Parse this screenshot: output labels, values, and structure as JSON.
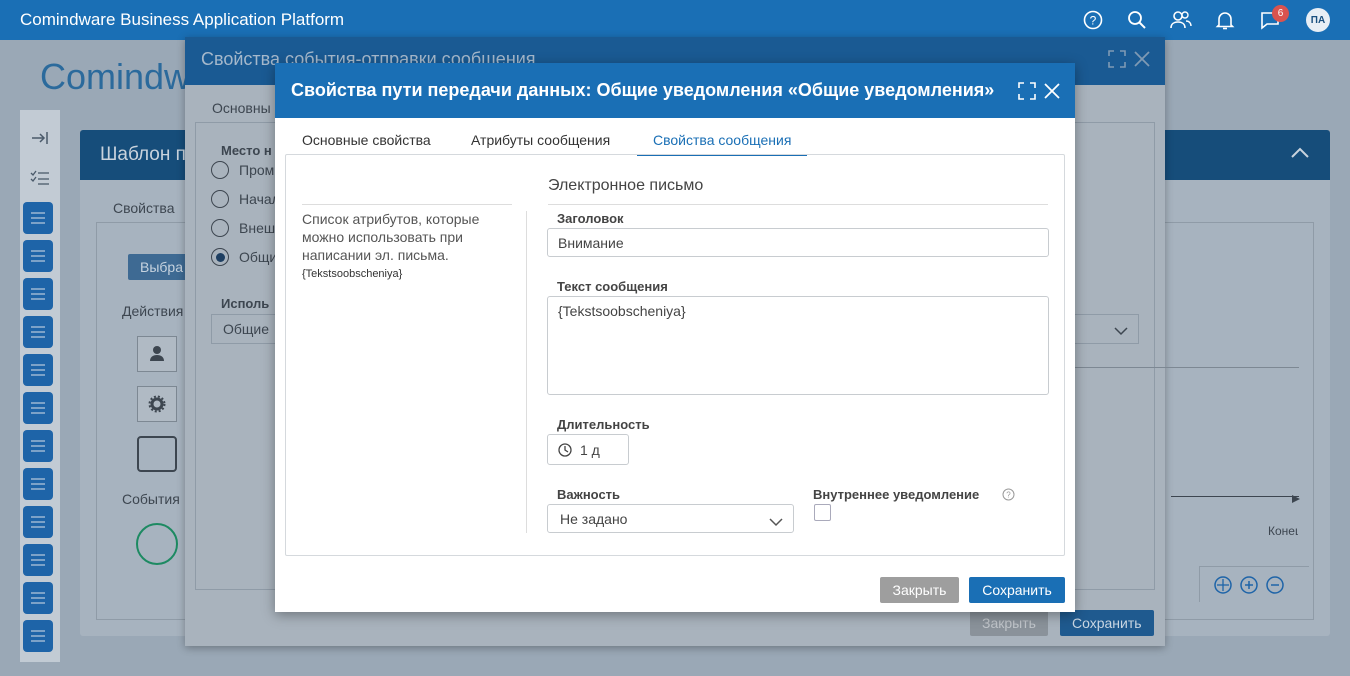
{
  "app": {
    "title": "Comindware Business Application Platform",
    "user_initials": "ПА",
    "notification_count": "6"
  },
  "background": {
    "logo_text": "Comindw",
    "card_title": "Шаблон п",
    "card_tab": "Свойства",
    "select_button": "Выбра",
    "actions_label": "Действия",
    "events_label": "События",
    "end_label": "Конец",
    "outer_dialog": {
      "title": "Свойства события-отправки сообщения",
      "tab": "Основны",
      "place_label": "Место н",
      "radios": [
        "Пром",
        "Начал",
        "Внеш",
        "Общи"
      ],
      "use_label": "Исполь",
      "use_value": "Общие",
      "close_button": "Закрыть",
      "save_button": "Сохранить"
    }
  },
  "modal": {
    "title": "Свойства пути передачи данных: Общие уведомления «Общие уведомления»",
    "tabs": [
      "Основные свойства",
      "Атрибуты сообщения",
      "Свойства сообщения"
    ],
    "active_tab": 2,
    "hint_text": "Список атрибутов, которые можно использовать при написании эл. письма.",
    "hint_var": "{Tekstsoobscheniya}",
    "section_title": "Электронное письмо",
    "subject": {
      "label": "Заголовок",
      "value": "Внимание"
    },
    "body": {
      "label": "Текст сообщения",
      "value": "{Tekstsoobscheniya}"
    },
    "duration": {
      "label": "Длительность",
      "value": "1 д"
    },
    "importance": {
      "label": "Важность",
      "value": "Не задано"
    },
    "internal": {
      "label": "Внутреннее уведомление",
      "checked": false
    },
    "close_button": "Закрыть",
    "save_button": "Сохранить"
  },
  "colors": {
    "primary": "#1a6fb5",
    "close_btn": "#9e9e9e",
    "badge": "#d9534f"
  }
}
